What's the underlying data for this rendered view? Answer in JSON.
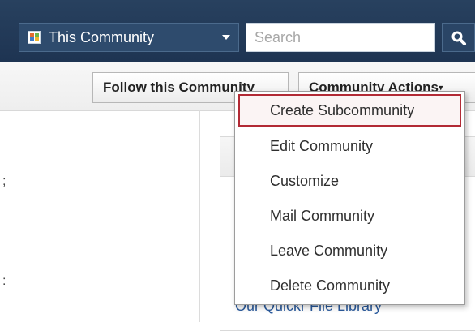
{
  "topbar": {
    "scope_label": "This Community",
    "search_placeholder": "Search"
  },
  "actionbar": {
    "follow_label": "Follow this Community",
    "actions_label": "Community Actions",
    "actions_caret": "▾"
  },
  "left_fragments": [
    ";",
    ":"
  ],
  "panel": {
    "link_text": "Our Quickr File Library"
  },
  "menu": {
    "items": [
      {
        "label": "Create Subcommunity",
        "highlighted": true
      },
      {
        "label": "Edit Community",
        "highlighted": false
      },
      {
        "label": "Customize",
        "highlighted": false
      },
      {
        "label": "Mail Community",
        "highlighted": false
      },
      {
        "label": "Leave Community",
        "highlighted": false
      },
      {
        "label": "Delete Community",
        "highlighted": false
      }
    ]
  },
  "colors": {
    "header_bg": "#22395a",
    "highlight_border": "#b22a35",
    "link": "#2a5a9c"
  }
}
